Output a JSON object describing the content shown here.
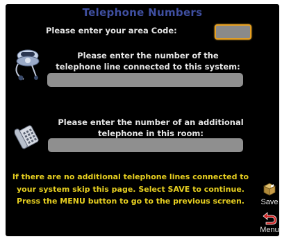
{
  "page": {
    "title": "Telephone Numbers"
  },
  "area_code": {
    "label": "Please enter your area Code:",
    "value": ""
  },
  "phone_line": {
    "label": "Please enter the number of the telephone line connected to this system:",
    "value": ""
  },
  "additional_phone": {
    "label": "Please enter the number of an additional telephone in this room:",
    "value": ""
  },
  "instructions": {
    "text": "If there are no additional telephone lines connected to your system skip this page. Select SAVE to continue. Press the MENU button to go to the previous screen."
  },
  "buttons": {
    "save_label": "Save",
    "menu_label": "Menu"
  },
  "icons": {
    "phone": "rotary-phone-icon",
    "extension_phone": "desk-phone-icon",
    "save": "save-box-icon",
    "menu": "back-arrow-icon"
  },
  "colors": {
    "background": "#000000",
    "title": "#3f4fa0",
    "label": "#e6e6e6",
    "instructions": "#e8d020",
    "field": "#8f8f8f",
    "focus_border": "#e8a020",
    "menu_arrow": "#d02020"
  }
}
